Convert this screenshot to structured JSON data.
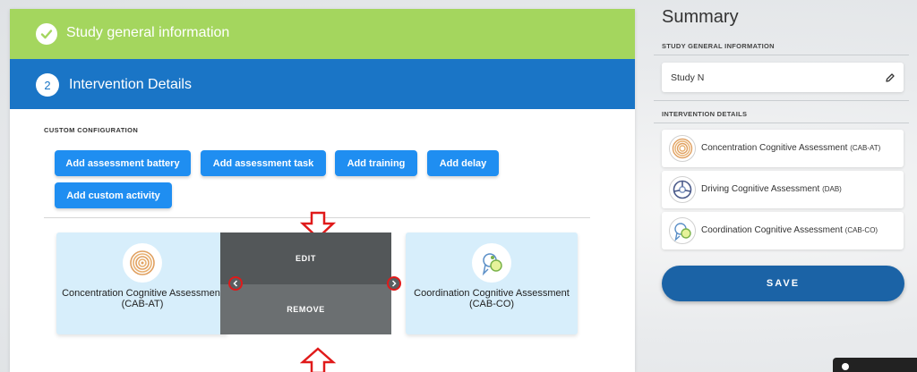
{
  "steps": {
    "step1": {
      "label": "Study general information",
      "icon": "check-icon",
      "color": "#a4d65e"
    },
    "step2": {
      "number": "2",
      "label": "Intervention Details",
      "color": "#1a75c6"
    }
  },
  "custom_config": {
    "title": "CUSTOM CONFIGURATION",
    "buttons": [
      "Add assessment battery",
      "Add assessment task",
      "Add training",
      "Add delay",
      "Add custom activity"
    ]
  },
  "cards": [
    {
      "title": "Concentration Cognitive Assessment (CAB-AT)",
      "icon": "concentric-circles-icon"
    },
    {
      "title": "Coordination Cognitive Assessment (CAB-CO)",
      "icon": "coordination-icon"
    }
  ],
  "overlay": {
    "edit": "EDIT",
    "remove": "REMOVE"
  },
  "summary": {
    "title": "Summary",
    "study_section": "STUDY GENERAL INFORMATION",
    "study_name": "Study N",
    "intervention_section": "INTERVENTION DETAILS",
    "items": [
      {
        "name": "Concentration Cognitive Assessment",
        "code": "(CAB-AT)",
        "icon": "concentric-circles-icon"
      },
      {
        "name": "Driving Cognitive Assessment",
        "code": "(DAB)",
        "icon": "steering-wheel-icon"
      },
      {
        "name": "Coordination Cognitive Assessment",
        "code": "(CAB-CO)",
        "icon": "coordination-icon"
      }
    ],
    "save_label": "SAVE"
  },
  "colors": {
    "accent_blue": "#1f8ef1",
    "save_blue": "#1b63a6",
    "annotation_red": "#e01a1a"
  }
}
